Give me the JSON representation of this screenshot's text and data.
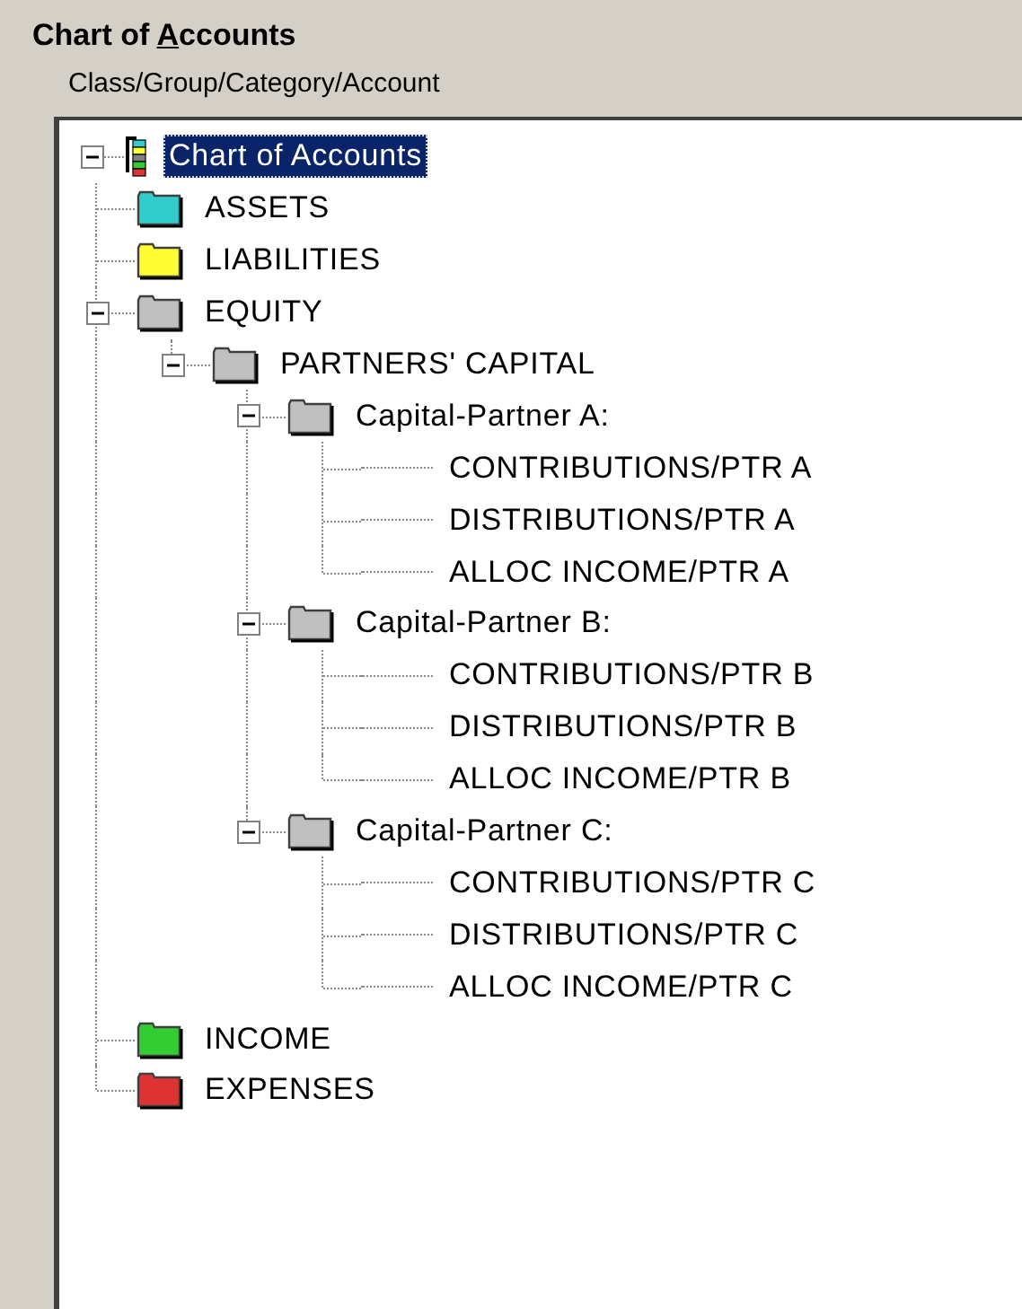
{
  "title": {
    "text": "Chart of ",
    "access_key": "A",
    "rest": "ccounts"
  },
  "subtitle": "Class/Group/Category/Account",
  "tree": [
    {
      "label": "Chart of Accounts",
      "kind": "root",
      "expanded": true,
      "selected": true,
      "children": [
        {
          "label": "ASSETS",
          "kind": "folder",
          "color": "#33cccc",
          "selected": false
        },
        {
          "label": "LIABILITIES",
          "kind": "folder",
          "color": "#ffff33",
          "selected": false
        },
        {
          "label": "EQUITY",
          "kind": "folder",
          "color": "#c0c0c0",
          "expanded": true,
          "selected": false,
          "children": [
            {
              "label": "PARTNERS' CAPITAL",
              "kind": "folder",
              "color": "#c0c0c0",
              "expanded": true,
              "selected": false,
              "children": [
                {
                  "label": "Capital-Partner A:",
                  "kind": "folder",
                  "color": "#c0c0c0",
                  "expanded": true,
                  "selected": false,
                  "children": [
                    {
                      "label": "CONTRIBUTIONS/PTR A",
                      "kind": "account",
                      "selected": false
                    },
                    {
                      "label": "DISTRIBUTIONS/PTR A",
                      "kind": "account",
                      "selected": false
                    },
                    {
                      "label": "ALLOC INCOME/PTR A",
                      "kind": "account",
                      "selected": false
                    }
                  ]
                },
                {
                  "label": "Capital-Partner B:",
                  "kind": "folder",
                  "color": "#c0c0c0",
                  "expanded": true,
                  "selected": false,
                  "children": [
                    {
                      "label": "CONTRIBUTIONS/PTR B",
                      "kind": "account",
                      "selected": false
                    },
                    {
                      "label": "DISTRIBUTIONS/PTR B",
                      "kind": "account",
                      "selected": false
                    },
                    {
                      "label": "ALLOC INCOME/PTR B",
                      "kind": "account",
                      "selected": false
                    }
                  ]
                },
                {
                  "label": "Capital-Partner C:",
                  "kind": "folder",
                  "color": "#c0c0c0",
                  "expanded": true,
                  "selected": false,
                  "children": [
                    {
                      "label": "CONTRIBUTIONS/PTR C",
                      "kind": "account",
                      "selected": false
                    },
                    {
                      "label": "DISTRIBUTIONS/PTR C",
                      "kind": "account",
                      "selected": false
                    },
                    {
                      "label": "ALLOC INCOME/PTR C",
                      "kind": "account",
                      "selected": false
                    }
                  ]
                }
              ]
            }
          ]
        },
        {
          "label": "INCOME",
          "kind": "folder",
          "color": "#33cc33",
          "selected": false
        },
        {
          "label": "EXPENSES",
          "kind": "folder",
          "color": "#dd3333",
          "selected": false
        }
      ]
    }
  ]
}
